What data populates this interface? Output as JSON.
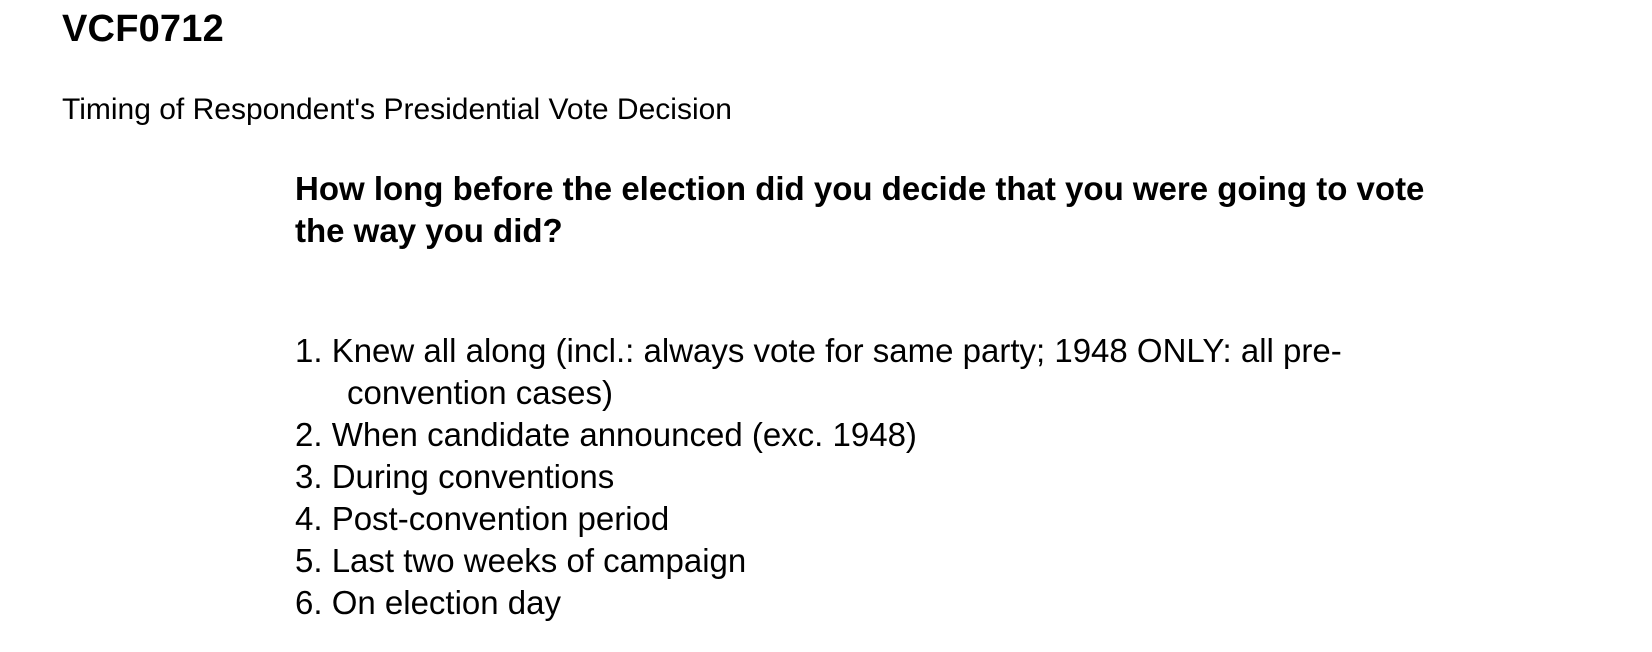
{
  "header": {
    "code": "VCF0712",
    "label": "Timing of Respondent's Presidential Vote Decision"
  },
  "question": "How long before the election did you decide that you were going to vote the way you did?",
  "options": [
    {
      "line1": "1. Knew all along (incl.: always vote for same party; 1948 ONLY: all pre-",
      "line2": "convention cases)"
    },
    {
      "line1": "2. When candidate announced (exc. 1948)"
    },
    {
      "line1": "3. During conventions"
    },
    {
      "line1": "4. Post-convention period"
    },
    {
      "line1": "5. Last two weeks of campaign"
    },
    {
      "line1": "6. On election day"
    }
  ]
}
